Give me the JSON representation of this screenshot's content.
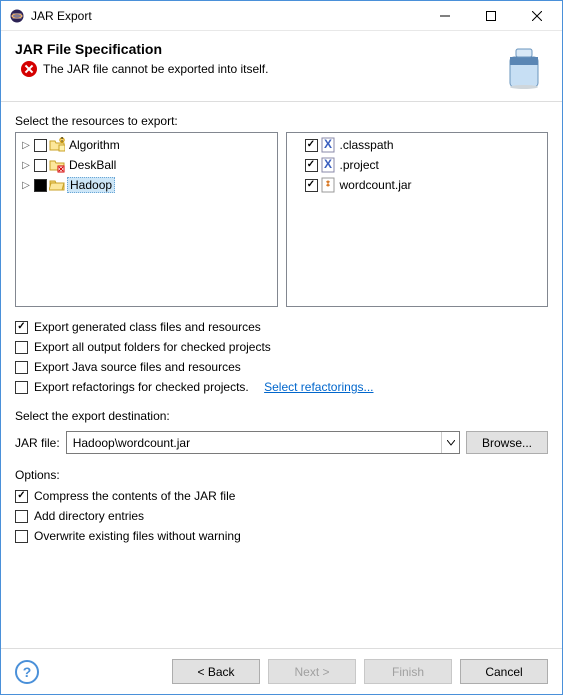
{
  "window": {
    "title": "JAR Export"
  },
  "header": {
    "title": "JAR File Specification",
    "error": "The JAR file cannot be exported into itself."
  },
  "resources": {
    "label": "Select the resources to export:",
    "projects": [
      {
        "name": "Algorithm",
        "checked": false,
        "expandable": true,
        "selected": false,
        "deco": "warn"
      },
      {
        "name": "DeskBall",
        "checked": false,
        "expandable": true,
        "selected": false,
        "deco": "err"
      },
      {
        "name": "Hadoop",
        "checked": "filled",
        "expandable": true,
        "selected": true,
        "deco": "none"
      }
    ],
    "files": [
      {
        "name": ".classpath",
        "checked": true,
        "kind": "x"
      },
      {
        "name": ".project",
        "checked": true,
        "kind": "x"
      },
      {
        "name": "wordcount.jar",
        "checked": true,
        "kind": "jar"
      }
    ]
  },
  "exportFlags": {
    "genClass": {
      "label": "Export generated class files and resources",
      "checked": true
    },
    "allOutput": {
      "label": "Export all output folders for checked projects",
      "checked": false
    },
    "javaSrc": {
      "label": "Export Java source files and resources",
      "checked": false
    },
    "refactor": {
      "label": "Export refactorings for checked projects.",
      "checked": false
    },
    "refactorLink": "Select refactorings..."
  },
  "destination": {
    "label": "Select the export destination:",
    "fieldLabel": "JAR file:",
    "value": "Hadoop\\wordcount.jar",
    "browse": "Browse..."
  },
  "options": {
    "label": "Options:",
    "compress": {
      "label": "Compress the contents of the JAR file",
      "checked": true
    },
    "addDir": {
      "label": "Add directory entries",
      "checked": false
    },
    "overwrite": {
      "label": "Overwrite existing files without warning",
      "checked": false
    }
  },
  "footer": {
    "back": "< Back",
    "next": "Next >",
    "finish": "Finish",
    "cancel": "Cancel"
  }
}
